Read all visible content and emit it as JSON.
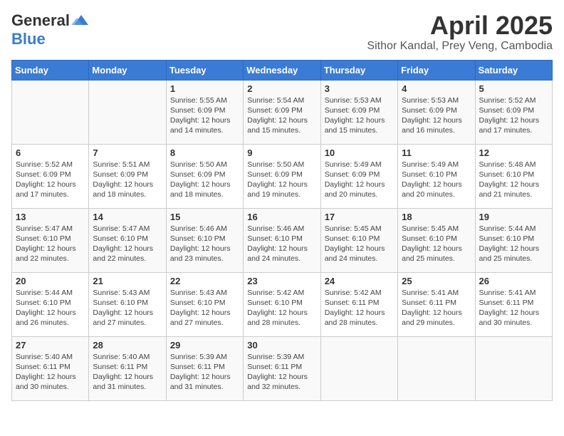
{
  "header": {
    "logo_general": "General",
    "logo_blue": "Blue",
    "month": "April 2025",
    "location": "Sithor Kandal, Prey Veng, Cambodia"
  },
  "days_of_week": [
    "Sunday",
    "Monday",
    "Tuesday",
    "Wednesday",
    "Thursday",
    "Friday",
    "Saturday"
  ],
  "weeks": [
    [
      {
        "day": "",
        "sunrise": "",
        "sunset": "",
        "daylight": ""
      },
      {
        "day": "",
        "sunrise": "",
        "sunset": "",
        "daylight": ""
      },
      {
        "day": "1",
        "sunrise": "Sunrise: 5:55 AM",
        "sunset": "Sunset: 6:09 PM",
        "daylight": "Daylight: 12 hours and 14 minutes."
      },
      {
        "day": "2",
        "sunrise": "Sunrise: 5:54 AM",
        "sunset": "Sunset: 6:09 PM",
        "daylight": "Daylight: 12 hours and 15 minutes."
      },
      {
        "day": "3",
        "sunrise": "Sunrise: 5:53 AM",
        "sunset": "Sunset: 6:09 PM",
        "daylight": "Daylight: 12 hours and 15 minutes."
      },
      {
        "day": "4",
        "sunrise": "Sunrise: 5:53 AM",
        "sunset": "Sunset: 6:09 PM",
        "daylight": "Daylight: 12 hours and 16 minutes."
      },
      {
        "day": "5",
        "sunrise": "Sunrise: 5:52 AM",
        "sunset": "Sunset: 6:09 PM",
        "daylight": "Daylight: 12 hours and 17 minutes."
      }
    ],
    [
      {
        "day": "6",
        "sunrise": "Sunrise: 5:52 AM",
        "sunset": "Sunset: 6:09 PM",
        "daylight": "Daylight: 12 hours and 17 minutes."
      },
      {
        "day": "7",
        "sunrise": "Sunrise: 5:51 AM",
        "sunset": "Sunset: 6:09 PM",
        "daylight": "Daylight: 12 hours and 18 minutes."
      },
      {
        "day": "8",
        "sunrise": "Sunrise: 5:50 AM",
        "sunset": "Sunset: 6:09 PM",
        "daylight": "Daylight: 12 hours and 18 minutes."
      },
      {
        "day": "9",
        "sunrise": "Sunrise: 5:50 AM",
        "sunset": "Sunset: 6:09 PM",
        "daylight": "Daylight: 12 hours and 19 minutes."
      },
      {
        "day": "10",
        "sunrise": "Sunrise: 5:49 AM",
        "sunset": "Sunset: 6:09 PM",
        "daylight": "Daylight: 12 hours and 20 minutes."
      },
      {
        "day": "11",
        "sunrise": "Sunrise: 5:49 AM",
        "sunset": "Sunset: 6:10 PM",
        "daylight": "Daylight: 12 hours and 20 minutes."
      },
      {
        "day": "12",
        "sunrise": "Sunrise: 5:48 AM",
        "sunset": "Sunset: 6:10 PM",
        "daylight": "Daylight: 12 hours and 21 minutes."
      }
    ],
    [
      {
        "day": "13",
        "sunrise": "Sunrise: 5:47 AM",
        "sunset": "Sunset: 6:10 PM",
        "daylight": "Daylight: 12 hours and 22 minutes."
      },
      {
        "day": "14",
        "sunrise": "Sunrise: 5:47 AM",
        "sunset": "Sunset: 6:10 PM",
        "daylight": "Daylight: 12 hours and 22 minutes."
      },
      {
        "day": "15",
        "sunrise": "Sunrise: 5:46 AM",
        "sunset": "Sunset: 6:10 PM",
        "daylight": "Daylight: 12 hours and 23 minutes."
      },
      {
        "day": "16",
        "sunrise": "Sunrise: 5:46 AM",
        "sunset": "Sunset: 6:10 PM",
        "daylight": "Daylight: 12 hours and 24 minutes."
      },
      {
        "day": "17",
        "sunrise": "Sunrise: 5:45 AM",
        "sunset": "Sunset: 6:10 PM",
        "daylight": "Daylight: 12 hours and 24 minutes."
      },
      {
        "day": "18",
        "sunrise": "Sunrise: 5:45 AM",
        "sunset": "Sunset: 6:10 PM",
        "daylight": "Daylight: 12 hours and 25 minutes."
      },
      {
        "day": "19",
        "sunrise": "Sunrise: 5:44 AM",
        "sunset": "Sunset: 6:10 PM",
        "daylight": "Daylight: 12 hours and 25 minutes."
      }
    ],
    [
      {
        "day": "20",
        "sunrise": "Sunrise: 5:44 AM",
        "sunset": "Sunset: 6:10 PM",
        "daylight": "Daylight: 12 hours and 26 minutes."
      },
      {
        "day": "21",
        "sunrise": "Sunrise: 5:43 AM",
        "sunset": "Sunset: 6:10 PM",
        "daylight": "Daylight: 12 hours and 27 minutes."
      },
      {
        "day": "22",
        "sunrise": "Sunrise: 5:43 AM",
        "sunset": "Sunset: 6:10 PM",
        "daylight": "Daylight: 12 hours and 27 minutes."
      },
      {
        "day": "23",
        "sunrise": "Sunrise: 5:42 AM",
        "sunset": "Sunset: 6:10 PM",
        "daylight": "Daylight: 12 hours and 28 minutes."
      },
      {
        "day": "24",
        "sunrise": "Sunrise: 5:42 AM",
        "sunset": "Sunset: 6:11 PM",
        "daylight": "Daylight: 12 hours and 28 minutes."
      },
      {
        "day": "25",
        "sunrise": "Sunrise: 5:41 AM",
        "sunset": "Sunset: 6:11 PM",
        "daylight": "Daylight: 12 hours and 29 minutes."
      },
      {
        "day": "26",
        "sunrise": "Sunrise: 5:41 AM",
        "sunset": "Sunset: 6:11 PM",
        "daylight": "Daylight: 12 hours and 30 minutes."
      }
    ],
    [
      {
        "day": "27",
        "sunrise": "Sunrise: 5:40 AM",
        "sunset": "Sunset: 6:11 PM",
        "daylight": "Daylight: 12 hours and 30 minutes."
      },
      {
        "day": "28",
        "sunrise": "Sunrise: 5:40 AM",
        "sunset": "Sunset: 6:11 PM",
        "daylight": "Daylight: 12 hours and 31 minutes."
      },
      {
        "day": "29",
        "sunrise": "Sunrise: 5:39 AM",
        "sunset": "Sunset: 6:11 PM",
        "daylight": "Daylight: 12 hours and 31 minutes."
      },
      {
        "day": "30",
        "sunrise": "Sunrise: 5:39 AM",
        "sunset": "Sunset: 6:11 PM",
        "daylight": "Daylight: 12 hours and 32 minutes."
      },
      {
        "day": "",
        "sunrise": "",
        "sunset": "",
        "daylight": ""
      },
      {
        "day": "",
        "sunrise": "",
        "sunset": "",
        "daylight": ""
      },
      {
        "day": "",
        "sunrise": "",
        "sunset": "",
        "daylight": ""
      }
    ]
  ]
}
